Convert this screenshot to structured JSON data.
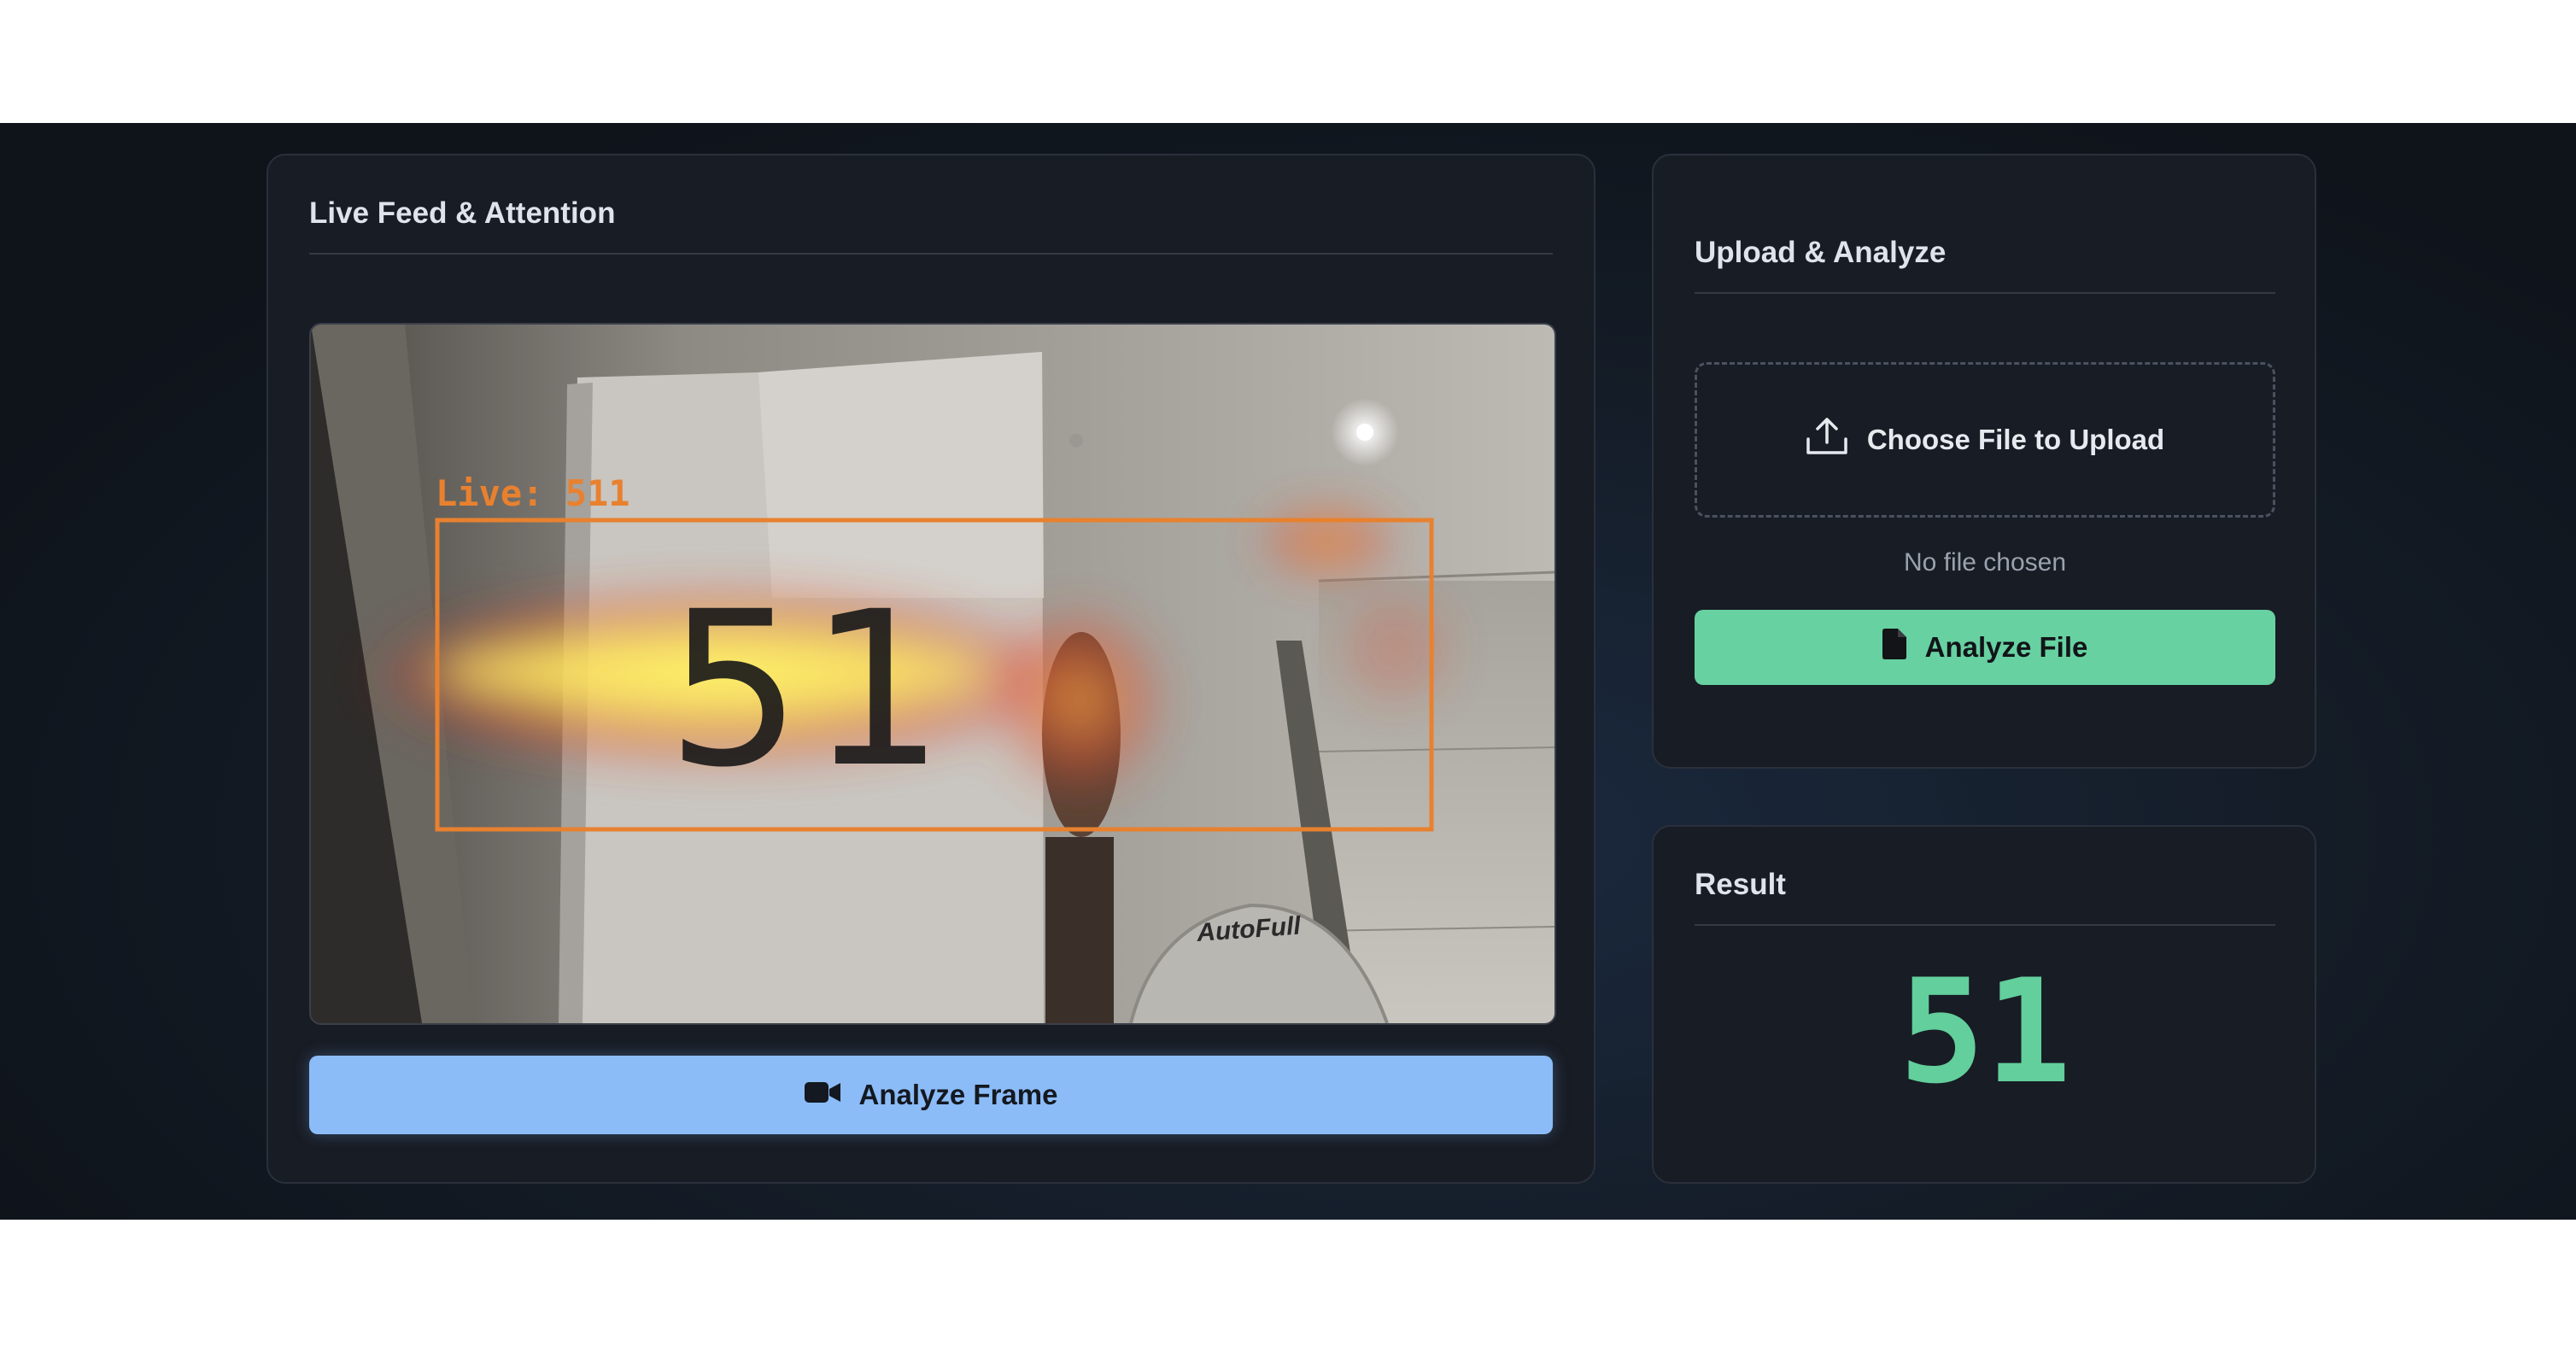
{
  "live_panel": {
    "title": "Live Feed & Attention",
    "overlay_label": "Live: 511",
    "handwritten_digits": "51",
    "chair_brand": "AutoFull",
    "analyze_button_label": "Analyze Frame",
    "analyze_button_icon": "video-camera-icon"
  },
  "upload_panel": {
    "title": "Upload & Analyze",
    "dropzone_label": "Choose File to Upload",
    "dropzone_icon": "upload-icon",
    "file_status": "No file chosen",
    "analyze_button_label": "Analyze File",
    "analyze_button_icon": "file-icon"
  },
  "result_panel": {
    "title": "Result",
    "value": "51"
  },
  "colors": {
    "frame_button": "#8bbcf7",
    "file_button": "#67d1a1",
    "result_value": "#62cf9c",
    "overlay_box": "#e8812f"
  }
}
